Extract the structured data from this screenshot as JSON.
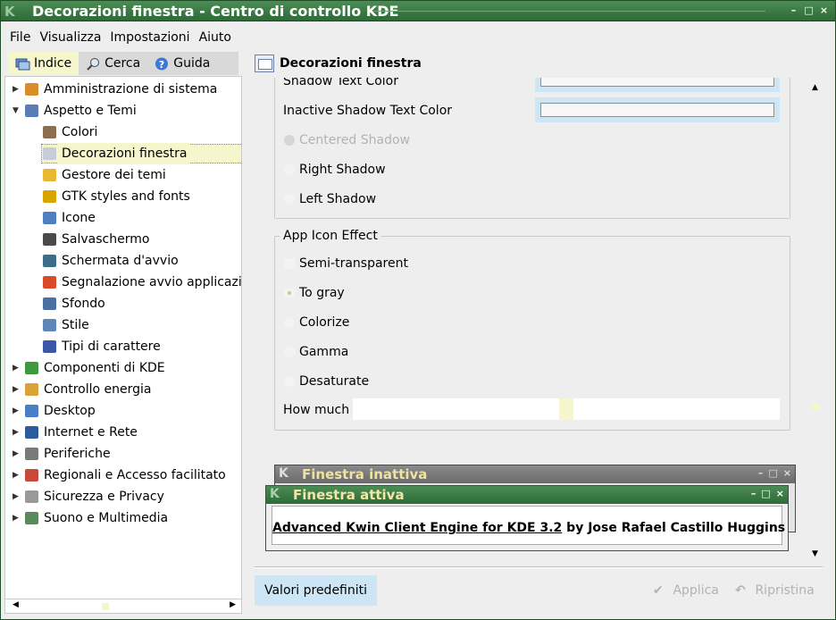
{
  "window": {
    "title": "Decorazioni finestra - Centro di controllo KDE",
    "k_logo": "K",
    "buttons": [
      "–",
      "□",
      "×"
    ]
  },
  "menubar": {
    "items": [
      "File",
      "Visualizza",
      "Impostazioni",
      "Aiuto"
    ]
  },
  "sidebar": {
    "tabs": [
      {
        "label": "Indice",
        "icon": "index-icon",
        "active": true
      },
      {
        "label": "Cerca",
        "icon": "search-icon",
        "active": false
      },
      {
        "label": "Guida",
        "icon": "help-icon",
        "active": false
      }
    ],
    "tree": [
      {
        "label": "Amministrazione di sistema",
        "level": 0,
        "expanded": false,
        "icon_color": "#d98c2b"
      },
      {
        "label": "Aspetto e Temi",
        "level": 0,
        "expanded": true,
        "icon_color": "#5a7db8"
      },
      {
        "label": "Colori",
        "level": 1,
        "icon_color": "#8b6f4e"
      },
      {
        "label": "Decorazioni finestra",
        "level": 1,
        "selected": true,
        "icon_color": "#c8ccd8"
      },
      {
        "label": "Gestore dei temi",
        "level": 1,
        "icon_color": "#e8b830"
      },
      {
        "label": "GTK styles and fonts",
        "level": 1,
        "icon_color": "#d6a500"
      },
      {
        "label": "Icone",
        "level": 1,
        "icon_color": "#4f7fc0"
      },
      {
        "label": "Salvaschermo",
        "level": 1,
        "icon_color": "#4a4a4a"
      },
      {
        "label": "Schermata d'avvio",
        "level": 1,
        "icon_color": "#3c6e8c"
      },
      {
        "label": "Segnalazione avvio applicazio",
        "level": 1,
        "icon_color": "#d84b2a"
      },
      {
        "label": "Sfondo",
        "level": 1,
        "icon_color": "#4b6fa0"
      },
      {
        "label": "Stile",
        "level": 1,
        "icon_color": "#5f86b8"
      },
      {
        "label": "Tipi di carattere",
        "level": 1,
        "icon_color": "#3b57a8"
      },
      {
        "label": "Componenti di KDE",
        "level": 0,
        "expanded": false,
        "icon_color": "#3f9a3f"
      },
      {
        "label": "Controllo energia",
        "level": 0,
        "expanded": false,
        "icon_color": "#d9a33a"
      },
      {
        "label": "Desktop",
        "level": 0,
        "expanded": false,
        "icon_color": "#4a7fc8"
      },
      {
        "label": "Internet e Rete",
        "level": 0,
        "expanded": false,
        "icon_color": "#2c5b9c"
      },
      {
        "label": "Periferiche",
        "level": 0,
        "expanded": false,
        "icon_color": "#7a7a7a"
      },
      {
        "label": "Regionali e Accesso facilitato",
        "level": 0,
        "expanded": false,
        "icon_color": "#c84a3a"
      },
      {
        "label": "Sicurezza e Privacy",
        "level": 0,
        "expanded": false,
        "icon_color": "#9a9a9a"
      },
      {
        "label": "Suono e Multimedia",
        "level": 0,
        "expanded": false,
        "icon_color": "#5a8a5a"
      }
    ]
  },
  "module": {
    "title": "Decorazioni finestra",
    "icon": "window-decoration-icon"
  },
  "settings": {
    "shadow_text_color_label": "Shadow Text Color",
    "inactive_shadow_text_color_label": "Inactive Shadow Text Color",
    "shadow_positions": [
      {
        "label": "Centered Shadow",
        "enabled": false,
        "checked": false
      },
      {
        "label": "Right Shadow",
        "enabled": true,
        "checked": false
      },
      {
        "label": "Left Shadow",
        "enabled": true,
        "checked": false
      }
    ],
    "app_icon_effect": {
      "title": "App Icon Effect",
      "semi_transparent_label": "Semi-transparent",
      "options": [
        {
          "label": "To gray",
          "checked": true
        },
        {
          "label": "Colorize",
          "checked": false
        },
        {
          "label": "Gamma",
          "checked": false
        },
        {
          "label": "Desaturate",
          "checked": false
        }
      ],
      "how_much_label": "How much"
    }
  },
  "preview": {
    "inactive_title": "Finestra inattiva",
    "active_title": "Finestra attiva",
    "text_link": "Advanced Kwin Client Engine for KDE 3.2",
    "text_rest": " by Jose Rafael Castillo Huggins"
  },
  "buttons": {
    "defaults": "Valori predefiniti",
    "apply": "Applica",
    "reset": "Ripristina",
    "apply_icon": "✔",
    "reset_icon": "↶"
  }
}
